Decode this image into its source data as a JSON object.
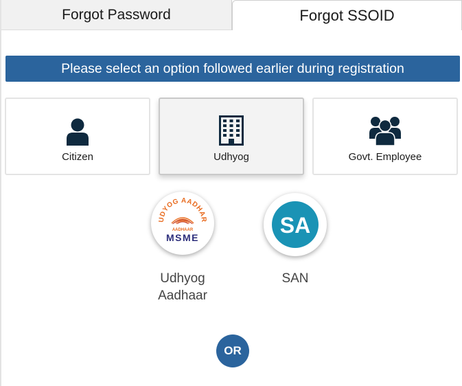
{
  "tabs": [
    {
      "label": "Forgot Password",
      "active": false
    },
    {
      "label": "Forgot SSOID",
      "active": true
    }
  ],
  "banner": {
    "text": "Please select an option followed earlier during registration"
  },
  "user_types": [
    {
      "label": "Citizen",
      "icon": "user-icon",
      "selected": false
    },
    {
      "label": "Udhyog",
      "icon": "building-icon",
      "selected": true
    },
    {
      "label": "Govt. Employee",
      "icon": "users-group-icon",
      "selected": false
    }
  ],
  "options": [
    {
      "label_line1": "Udhyog",
      "label_line2": "Aadhaar",
      "logo": "udyog-aadhar-logo",
      "logo_text_top": "UDYOG AADHAR",
      "logo_text_mid": "AADHAAR",
      "logo_text_bottom": "MSME"
    },
    {
      "label": "SAN",
      "logo": "san-logo",
      "logo_text": "SA"
    }
  ],
  "divider": {
    "text": "OR"
  },
  "colors": {
    "accent": "#2b649d",
    "icon_dark": "#0f2a3f",
    "san_blue": "#1a93b5",
    "logo_orange": "#e86b1f",
    "logo_navy": "#2d2f7c"
  }
}
